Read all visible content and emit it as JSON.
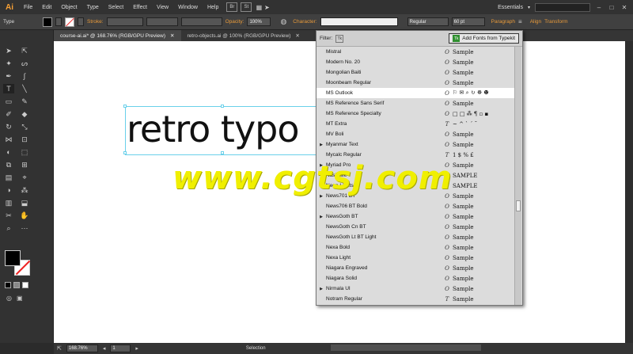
{
  "app": {
    "logo": "Ai",
    "colors": {
      "accent": "#f7a035",
      "selection": "#6ad0ea",
      "watermark": "#f0ef00"
    }
  },
  "menu": [
    "File",
    "Edit",
    "Object",
    "Type",
    "Select",
    "Effect",
    "View",
    "Window",
    "Help"
  ],
  "menubar_right": {
    "bridge": "Br",
    "stock": "St",
    "workspace": "Essentials",
    "win_buttons": [
      "–",
      "□",
      "✕"
    ]
  },
  "control": {
    "tool_label": "Type",
    "stroke_label": "Stroke:",
    "opacity_label": "Opacity:",
    "opacity_value": "100%",
    "character_label": "Character:",
    "font_search": "",
    "font_style": "Regular",
    "font_size": "60 pt",
    "paragraph_label": "Paragraph",
    "align_label": "Align",
    "transform_label": "Transform"
  },
  "tabs": [
    {
      "label": "course-ai.ai* @ 168.76% (RGB/GPU Preview)",
      "close": "✕",
      "active": true
    },
    {
      "label": "retro-objects.ai @ 100% (RGB/GPU Preview)",
      "close": "✕",
      "active": false
    }
  ],
  "artwork": {
    "text": "retro typo"
  },
  "watermark": "www.cgtsj.com",
  "font_menu": {
    "filter_label": "Filter:",
    "tk_icon": "Tk",
    "typekit_label": "Add Fonts from Typekit",
    "typekit_icon": "Tk",
    "fonts": [
      {
        "name": "Mistral",
        "type": "O",
        "sample": "Sample",
        "arrow": ""
      },
      {
        "name": "Modern No. 20",
        "type": "O",
        "sample": "Sample",
        "arrow": ""
      },
      {
        "name": "Mongolian Baiti",
        "type": "O",
        "sample": "Sample",
        "arrow": ""
      },
      {
        "name": "Moonbeam Regular",
        "type": "O",
        "sample": "Sample",
        "arrow": ""
      },
      {
        "name": "MS Outlook",
        "type": "O",
        "sample": "⚐ ✉ ⌕ ↻ ☸ ☻",
        "arrow": ""
      },
      {
        "name": "MS Reference Sans Serif",
        "type": "O",
        "sample": "Sample",
        "arrow": ""
      },
      {
        "name": "MS Reference Specialty",
        "type": "O",
        "sample": "□ □ ⁂ ¶ ▫ ▪",
        "arrow": ""
      },
      {
        "name": "MT Extra",
        "type": "T",
        "sample": "~ ^ ` ´ ˘",
        "arrow": ""
      },
      {
        "name": "MV Boli",
        "type": "O",
        "sample": "Sample",
        "arrow": ""
      },
      {
        "name": "Myanmar Text",
        "type": "O",
        "sample": "Sample",
        "arrow": "▶"
      },
      {
        "name": "Mycalc Regular",
        "type": "T",
        "sample": "1 $ % £",
        "arrow": ""
      },
      {
        "name": "Myriad Pro",
        "type": "O",
        "sample": "Sample",
        "arrow": "▶"
      },
      {
        "name": "Nashville",
        "type": "O",
        "sample": "SAMPLE",
        "arrow": ""
      },
      {
        "name": "Neon Lights",
        "type": "T",
        "sample": "SAMPLE",
        "arrow": ""
      },
      {
        "name": "News701 BT",
        "type": "O",
        "sample": "Sample",
        "arrow": "▶"
      },
      {
        "name": "News706 BT Bold",
        "type": "O",
        "sample": "Sample",
        "arrow": ""
      },
      {
        "name": "NewsGoth BT",
        "type": "O",
        "sample": "Sample",
        "arrow": "▶"
      },
      {
        "name": "NewsGoth Cn BT",
        "type": "O",
        "sample": "Sample",
        "arrow": ""
      },
      {
        "name": "NewsGoth Lt BT Light",
        "type": "O",
        "sample": "Sample",
        "arrow": ""
      },
      {
        "name": "Nexa Bold",
        "type": "O",
        "sample": "Sample",
        "arrow": ""
      },
      {
        "name": "Nexa Light",
        "type": "O",
        "sample": "Sample",
        "arrow": ""
      },
      {
        "name": "Niagara Engraved",
        "type": "O",
        "sample": "Sample",
        "arrow": ""
      },
      {
        "name": "Niagara Solid",
        "type": "O",
        "sample": "Sample",
        "arrow": ""
      },
      {
        "name": "Nirmala UI",
        "type": "O",
        "sample": "Sample",
        "arrow": "▶"
      },
      {
        "name": "Notram Regular",
        "type": "T",
        "sample": "Sample",
        "arrow": ""
      }
    ],
    "selected_index": 4
  },
  "status": {
    "zoom": "168.76%",
    "page": "1",
    "tool": "Selection"
  }
}
